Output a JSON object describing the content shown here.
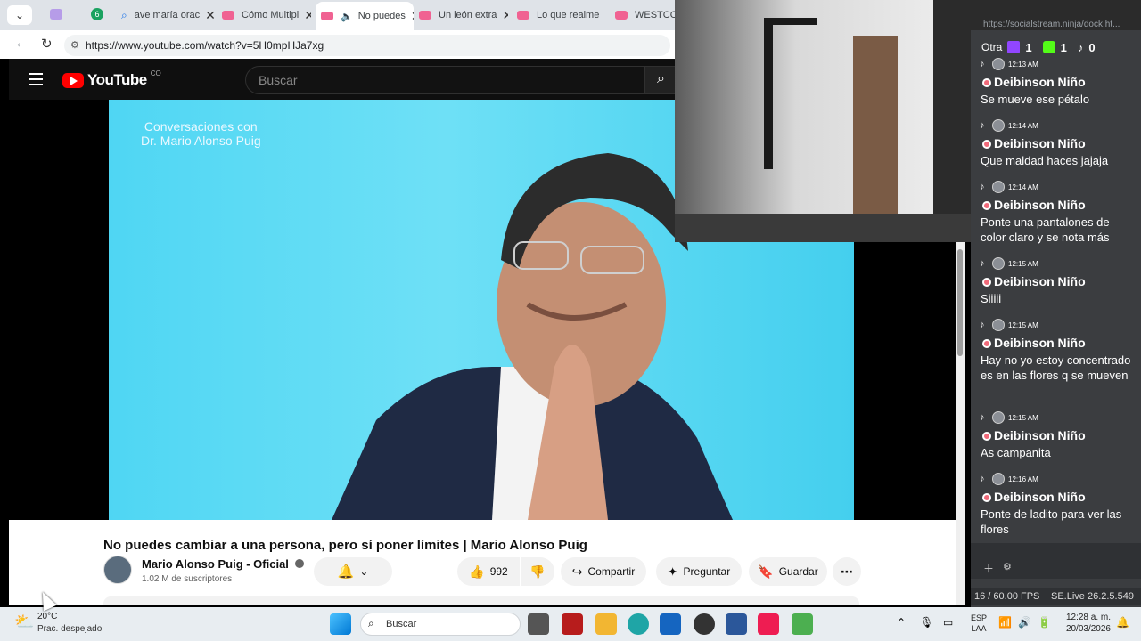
{
  "browser": {
    "tabs": [
      {
        "label": "ave maría orac",
        "active": false
      },
      {
        "label": "Cómo Multipl",
        "active": false
      },
      {
        "label": "No puedes",
        "active": true
      },
      {
        "label": "Un león extra",
        "active": false
      },
      {
        "label": "Lo que realme",
        "active": false
      },
      {
        "label": "WESTCOL",
        "active": false
      }
    ],
    "tab_badge": "6",
    "url": "https://www.youtube.com/watch?v=5H0mpHJa7xg"
  },
  "youtube": {
    "logo_text": "YouTube",
    "region": "CO",
    "search_placeholder": "Buscar",
    "overlay_line1": "Conversaciones con",
    "overlay_line2": "Dr. Mario Alonso Puig",
    "video_title": "No puedes cambiar a una persona, pero sí poner límites | Mario Alonso Puig",
    "channel_name": "Mario Alonso Puig - Oficial",
    "subscribers": "1.02 M de suscriptores",
    "likes": "992",
    "share_label": "Compartir",
    "ask_label": "Preguntar",
    "save_label": "Guardar"
  },
  "chat": {
    "url": "https://socialstream.ninja/dock.ht...",
    "header_prefix": "Otra",
    "counts": {
      "twitch": "1",
      "kick": "1",
      "tiktok": "0"
    },
    "messages": [
      {
        "time": "12:13 AM",
        "name": "Deibinson Niño",
        "text": "Se mueve ese pétalo"
      },
      {
        "time": "12:14 AM",
        "name": "Deibinson Niño",
        "text": "Que maldad haces jajaja"
      },
      {
        "time": "12:14 AM",
        "name": "Deibinson Niño",
        "text": "Ponte una pantalones de color claro y se nota más"
      },
      {
        "time": "12:15 AM",
        "name": "Deibinson Niño",
        "text": "Siiiii"
      },
      {
        "time": "12:15 AM",
        "name": "Deibinson Niño",
        "text": "Hay no yo estoy concentrado es en las flores q se mueven"
      },
      {
        "time": "12:15 AM",
        "name": "Deibinson Niño",
        "text": "As campanita"
      },
      {
        "time": "12:16 AM",
        "name": "Deibinson Niño",
        "text": "Ponte de ladito para ver las flores"
      }
    ],
    "fps": "16 / 60.00 FPS",
    "version": "SE.Live 26.2.5.549"
  },
  "taskbar": {
    "weather_temp": "20°C",
    "weather_desc": "Prac. despejado",
    "search_placeholder": "Buscar",
    "lang1": "ESP",
    "lang2": "LAA",
    "time": "12:28 a. m.",
    "date": "20/03/2026"
  }
}
